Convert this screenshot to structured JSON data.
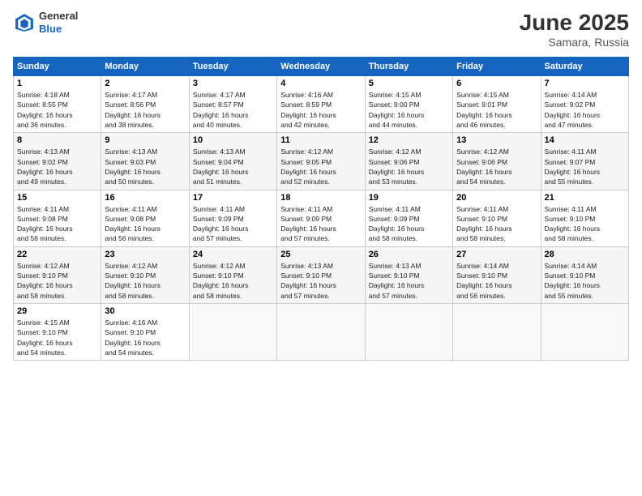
{
  "header": {
    "logo_general": "General",
    "logo_blue": "Blue",
    "title": "June 2025",
    "subtitle": "Samara, Russia"
  },
  "days_of_week": [
    "Sunday",
    "Monday",
    "Tuesday",
    "Wednesday",
    "Thursday",
    "Friday",
    "Saturday"
  ],
  "weeks": [
    [
      {
        "day": "1",
        "sunrise": "4:18 AM",
        "sunset": "8:55 PM",
        "daylight": "16 hours and 36 minutes."
      },
      {
        "day": "2",
        "sunrise": "4:17 AM",
        "sunset": "8:56 PM",
        "daylight": "16 hours and 38 minutes."
      },
      {
        "day": "3",
        "sunrise": "4:17 AM",
        "sunset": "8:57 PM",
        "daylight": "16 hours and 40 minutes."
      },
      {
        "day": "4",
        "sunrise": "4:16 AM",
        "sunset": "8:59 PM",
        "daylight": "16 hours and 42 minutes."
      },
      {
        "day": "5",
        "sunrise": "4:15 AM",
        "sunset": "9:00 PM",
        "daylight": "16 hours and 44 minutes."
      },
      {
        "day": "6",
        "sunrise": "4:15 AM",
        "sunset": "9:01 PM",
        "daylight": "16 hours and 46 minutes."
      },
      {
        "day": "7",
        "sunrise": "4:14 AM",
        "sunset": "9:02 PM",
        "daylight": "16 hours and 47 minutes."
      }
    ],
    [
      {
        "day": "8",
        "sunrise": "4:13 AM",
        "sunset": "9:02 PM",
        "daylight": "16 hours and 49 minutes."
      },
      {
        "day": "9",
        "sunrise": "4:13 AM",
        "sunset": "9:03 PM",
        "daylight": "16 hours and 50 minutes."
      },
      {
        "day": "10",
        "sunrise": "4:13 AM",
        "sunset": "9:04 PM",
        "daylight": "16 hours and 51 minutes."
      },
      {
        "day": "11",
        "sunrise": "4:12 AM",
        "sunset": "9:05 PM",
        "daylight": "16 hours and 52 minutes."
      },
      {
        "day": "12",
        "sunrise": "4:12 AM",
        "sunset": "9:06 PM",
        "daylight": "16 hours and 53 minutes."
      },
      {
        "day": "13",
        "sunrise": "4:12 AM",
        "sunset": "9:06 PM",
        "daylight": "16 hours and 54 minutes."
      },
      {
        "day": "14",
        "sunrise": "4:11 AM",
        "sunset": "9:07 PM",
        "daylight": "16 hours and 55 minutes."
      }
    ],
    [
      {
        "day": "15",
        "sunrise": "4:11 AM",
        "sunset": "9:08 PM",
        "daylight": "16 hours and 56 minutes."
      },
      {
        "day": "16",
        "sunrise": "4:11 AM",
        "sunset": "9:08 PM",
        "daylight": "16 hours and 56 minutes."
      },
      {
        "day": "17",
        "sunrise": "4:11 AM",
        "sunset": "9:09 PM",
        "daylight": "16 hours and 57 minutes."
      },
      {
        "day": "18",
        "sunrise": "4:11 AM",
        "sunset": "9:09 PM",
        "daylight": "16 hours and 57 minutes."
      },
      {
        "day": "19",
        "sunrise": "4:11 AM",
        "sunset": "9:09 PM",
        "daylight": "16 hours and 58 minutes."
      },
      {
        "day": "20",
        "sunrise": "4:11 AM",
        "sunset": "9:10 PM",
        "daylight": "16 hours and 58 minutes."
      },
      {
        "day": "21",
        "sunrise": "4:11 AM",
        "sunset": "9:10 PM",
        "daylight": "16 hours and 58 minutes."
      }
    ],
    [
      {
        "day": "22",
        "sunrise": "4:12 AM",
        "sunset": "9:10 PM",
        "daylight": "16 hours and 58 minutes."
      },
      {
        "day": "23",
        "sunrise": "4:12 AM",
        "sunset": "9:10 PM",
        "daylight": "16 hours and 58 minutes."
      },
      {
        "day": "24",
        "sunrise": "4:12 AM",
        "sunset": "9:10 PM",
        "daylight": "16 hours and 58 minutes."
      },
      {
        "day": "25",
        "sunrise": "4:13 AM",
        "sunset": "9:10 PM",
        "daylight": "16 hours and 57 minutes."
      },
      {
        "day": "26",
        "sunrise": "4:13 AM",
        "sunset": "9:10 PM",
        "daylight": "16 hours and 57 minutes."
      },
      {
        "day": "27",
        "sunrise": "4:14 AM",
        "sunset": "9:10 PM",
        "daylight": "16 hours and 56 minutes."
      },
      {
        "day": "28",
        "sunrise": "4:14 AM",
        "sunset": "9:10 PM",
        "daylight": "16 hours and 55 minutes."
      }
    ],
    [
      {
        "day": "29",
        "sunrise": "4:15 AM",
        "sunset": "9:10 PM",
        "daylight": "16 hours and 54 minutes."
      },
      {
        "day": "30",
        "sunrise": "4:16 AM",
        "sunset": "9:10 PM",
        "daylight": "16 hours and 54 minutes."
      },
      null,
      null,
      null,
      null,
      null
    ]
  ]
}
